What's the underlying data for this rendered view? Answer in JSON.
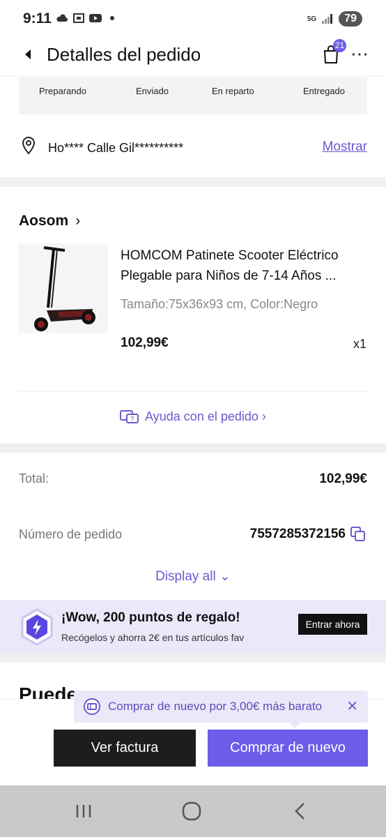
{
  "status_bar": {
    "time": "9:11",
    "network": "5G",
    "battery": "79"
  },
  "header": {
    "title": "Detalles del pedido",
    "cart_count": "21",
    "more": "⋯"
  },
  "steps": [
    "Preparando",
    "Enviado",
    "En reparto",
    "Entregado"
  ],
  "address": {
    "text": "Ho**** Calle Gil**********",
    "show_link": "Mostrar"
  },
  "store": {
    "name": "Aosom",
    "chevron": "›"
  },
  "product": {
    "name": "HOMCOM Patinete Scooter Eléctrico Plegable para Niños de 7-14 Años ...",
    "variant": "Tamaño:75x36x93 cm, Color:Negro",
    "price": "102,99€",
    "quantity": "x1"
  },
  "help": {
    "label": "Ayuda con el pedido ›"
  },
  "summary": {
    "total_label": "Total:",
    "total_value": "102,99€",
    "order_number_label": "Número de pedido",
    "order_number_value": "7557285372156",
    "display_all": "Display all ⌄"
  },
  "promo": {
    "title": "¡Wow, 200 puntos de regalo!",
    "subtitle": "Recógelos y ahorra 2€ en tus artículos fav",
    "button": "Entrar ahora"
  },
  "partial_heading": "Puede",
  "tooltip": {
    "text": "Comprar de nuevo por 3,00€ más barato",
    "close": "✕"
  },
  "actions": {
    "invoice": "Ver factura",
    "rebuy": "Comprar de nuevo"
  },
  "colors": {
    "accent": "#6c5ce7",
    "promo_bg": "#ebe8f9",
    "dark": "#1d1d1f"
  }
}
